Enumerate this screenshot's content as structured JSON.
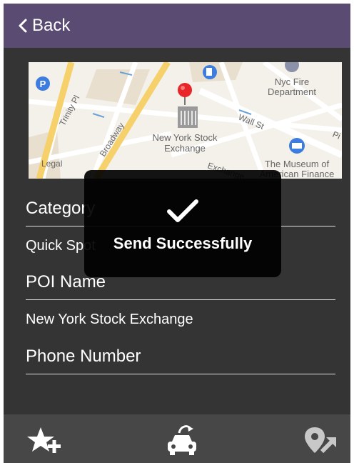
{
  "nav": {
    "back_label": "Back"
  },
  "map": {
    "labels": {
      "nyc_fire_1": "Nyc Fire",
      "nyc_fire_2": "Department",
      "trinity": "Trinity Pl",
      "broadway": "Broadway",
      "wall_st": "Wall St",
      "pine": "Pi",
      "exchange": "Exchange",
      "nyse_1": "New York Stock",
      "nyse_2": "Exchange",
      "museum_1": "The Museum of",
      "museum_2": "American Finance",
      "legal": "Legal"
    }
  },
  "form": {
    "category_label": "Category",
    "category_value": "Quick Spot",
    "poi_label": "POI Name",
    "poi_value": "New York Stock Exchange",
    "phone_label": "Phone Number"
  },
  "toast": {
    "message": "Send Successfully"
  },
  "icons": {
    "back": "chevron-left-icon",
    "favorite": "star-add-icon",
    "car": "car-send-icon",
    "navigate": "pin-navigate-icon",
    "checkmark": "checkmark-icon"
  },
  "colors": {
    "nav_bar": "#5a4b73",
    "background": "#343434",
    "bottom_bar": "#474747",
    "toast": "#000000",
    "map_pin": "#e8262a"
  }
}
